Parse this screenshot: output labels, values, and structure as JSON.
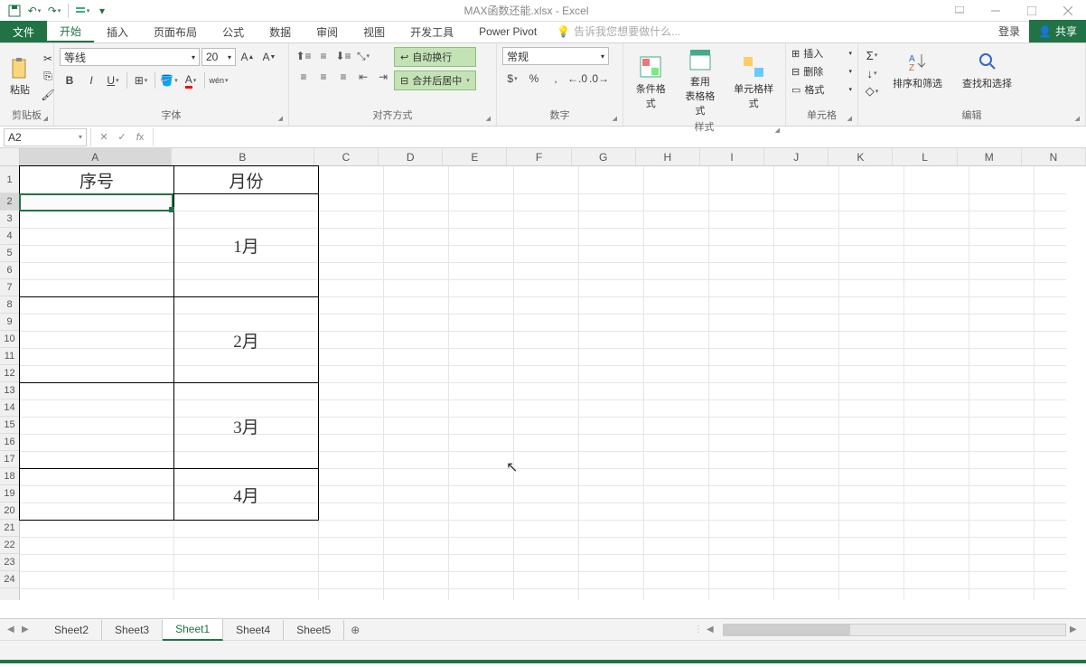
{
  "app": {
    "title": "MAX函数还能.xlsx - Excel"
  },
  "tabs": {
    "file": "文件",
    "home": "开始",
    "insert": "插入",
    "layout": "页面布局",
    "formulas": "公式",
    "data": "数据",
    "review": "审阅",
    "view": "视图",
    "dev": "开发工具",
    "pivot": "Power Pivot",
    "tellme": "告诉我您想要做什么...",
    "login": "登录",
    "share": "共享"
  },
  "ribbon": {
    "clipboard": {
      "paste": "粘贴",
      "label": "剪贴板"
    },
    "font": {
      "name": "等线",
      "size": "20",
      "label": "字体"
    },
    "align": {
      "wrap": "自动换行",
      "merge": "合并后居中",
      "label": "对齐方式"
    },
    "number": {
      "format": "常规",
      "label": "数字"
    },
    "styles": {
      "cond": "条件格式",
      "table": "套用\n表格格式",
      "cell": "单元格样式",
      "label": "样式"
    },
    "cells": {
      "insert": "插入",
      "delete": "删除",
      "format": "格式",
      "label": "单元格"
    },
    "edit": {
      "sort": "排序和筛选",
      "find": "查找和选择",
      "label": "编辑"
    }
  },
  "fx": {
    "cell": "A2"
  },
  "columns": [
    "A",
    "B",
    "C",
    "D",
    "E",
    "F",
    "G",
    "H",
    "I",
    "J",
    "K",
    "L",
    "M",
    "N"
  ],
  "rows": [
    "1",
    "2",
    "3",
    "4",
    "5",
    "6",
    "7",
    "8",
    "9",
    "10",
    "11",
    "12",
    "13",
    "14",
    "15",
    "16",
    "17",
    "18",
    "19",
    "20",
    "21",
    "22",
    "23",
    "24"
  ],
  "cells": {
    "A1": "序号",
    "B1": "月份",
    "B2": "1月",
    "B7": "2月",
    "B12": "3月",
    "B17": "4月"
  },
  "sheets": {
    "s1": "Sheet2",
    "s2": "Sheet3",
    "s3": "Sheet1",
    "s4": "Sheet4",
    "s5": "Sheet5"
  }
}
